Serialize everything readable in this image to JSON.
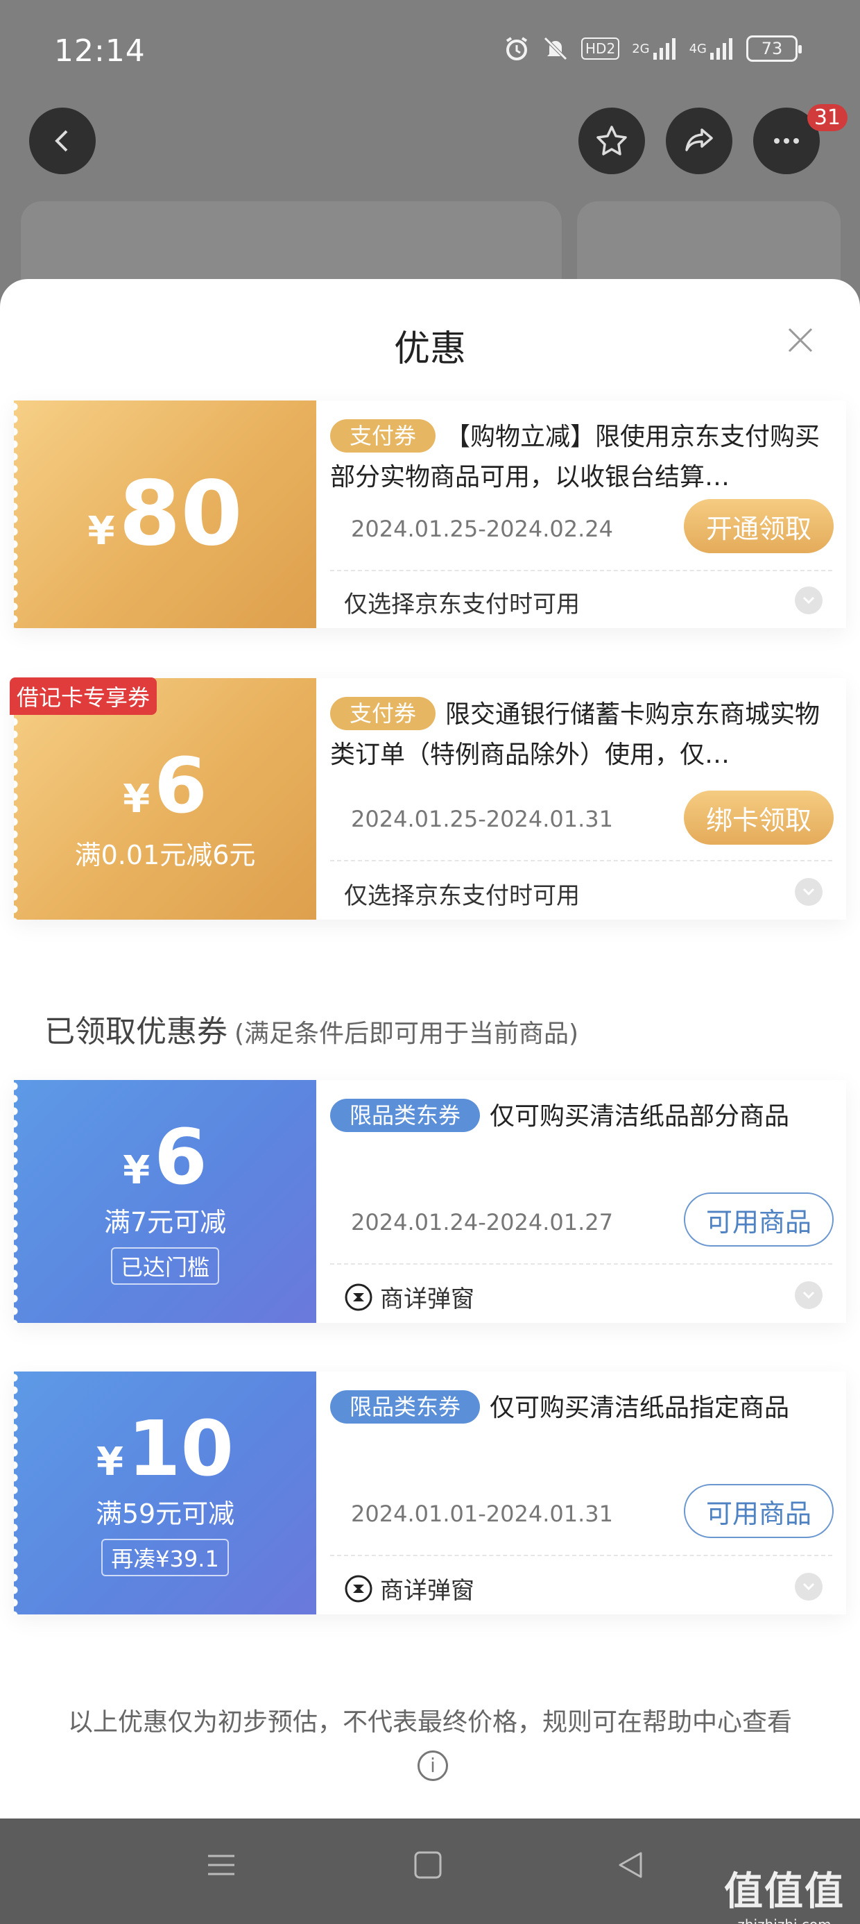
{
  "status_bar": {
    "time": "12:14",
    "hd_label": "HD2",
    "signal1_label": "2G",
    "signal2_label": "4G",
    "battery": "73"
  },
  "header": {
    "more_badge": "31"
  },
  "sheet": {
    "title": "优惠",
    "coupons": [
      {
        "currency": "¥",
        "amount": "80",
        "chip": "支付券",
        "description": "【购物立减】限使用京东支付购买部分实物商品可用，以收银台结算…",
        "date": "2024.01.25-2024.02.24",
        "action": "开通领取",
        "footer": "仅选择京东支付时可用"
      },
      {
        "corner_tag": "借记卡专享券",
        "currency": "¥",
        "amount": "6",
        "condition": "满0.01元减6元",
        "chip": "支付券",
        "description": "限交通银行储蓄卡购京东商城实物类订单（特例商品除外）使用，仅…",
        "date": "2024.01.25-2024.01.31",
        "action": "绑卡领取",
        "footer": "仅选择京东支付时可用"
      }
    ],
    "received_section": {
      "title": "已领取优惠券",
      "subtitle": "(满足条件后即可用于当前商品)"
    },
    "received_coupons": [
      {
        "currency": "¥",
        "amount": "6",
        "condition": "满7元可减",
        "tag": "已达门槛",
        "chip": "限品类东券",
        "description": "仅可购买清洁纸品部分商品",
        "date": "2024.01.24-2024.01.27",
        "action": "可用商品",
        "footer": "商详弹窗"
      },
      {
        "currency": "¥",
        "amount": "10",
        "condition": "满59元可减",
        "tag": "再凑¥39.1",
        "chip": "限品类东券",
        "description": "仅可购买清洁纸品指定商品",
        "date": "2024.01.01-2024.01.31",
        "action": "可用商品",
        "footer": "商详弹窗"
      }
    ],
    "disclaimer": "以上优惠仅为初步预估，不代表最终价格，规则可在帮助中心查看"
  },
  "watermark": {
    "line1": "值值值",
    "line2": "zhizhizhi.com"
  },
  "colors": {
    "gold": "#e6b663",
    "blue": "#5b8fd8",
    "sheet_bg": "#ffffff",
    "overlay": "#7f7f7f"
  }
}
